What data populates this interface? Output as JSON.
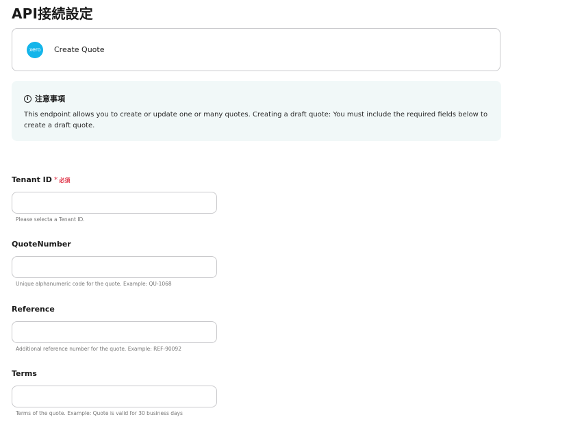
{
  "page": {
    "title": "API接続設定"
  },
  "app_card": {
    "logo_text": "xero",
    "name": "Create Quote"
  },
  "notice": {
    "icon": "info-icon",
    "icon_glyph": "i",
    "title": "注意事項",
    "body": "This endpoint allows you to create or update one or many quotes. Creating a draft quote: You must include the required fields below to create a draft quote."
  },
  "fields": {
    "tenant_id": {
      "label": "Tenant ID",
      "required_mark": "*",
      "required_text": "必須",
      "value": "",
      "help": "Please selecta a Tenant ID."
    },
    "quote_number": {
      "label": "QuoteNumber",
      "value": "",
      "help": "Unique alphanumeric code for the quote. Example: QU-1068"
    },
    "reference": {
      "label": "Reference",
      "value": "",
      "help": "Additional reference number for the quote. Example: REF-90092"
    },
    "terms": {
      "label": "Terms",
      "value": "",
      "help": "Terms of the quote. Example: Quote is valid for 30 business days"
    }
  },
  "colors": {
    "xero_brand": "#13b5ea",
    "required": "#e0364a",
    "notice_bg": "#f1f8f8",
    "border": "#c9c9cc"
  }
}
